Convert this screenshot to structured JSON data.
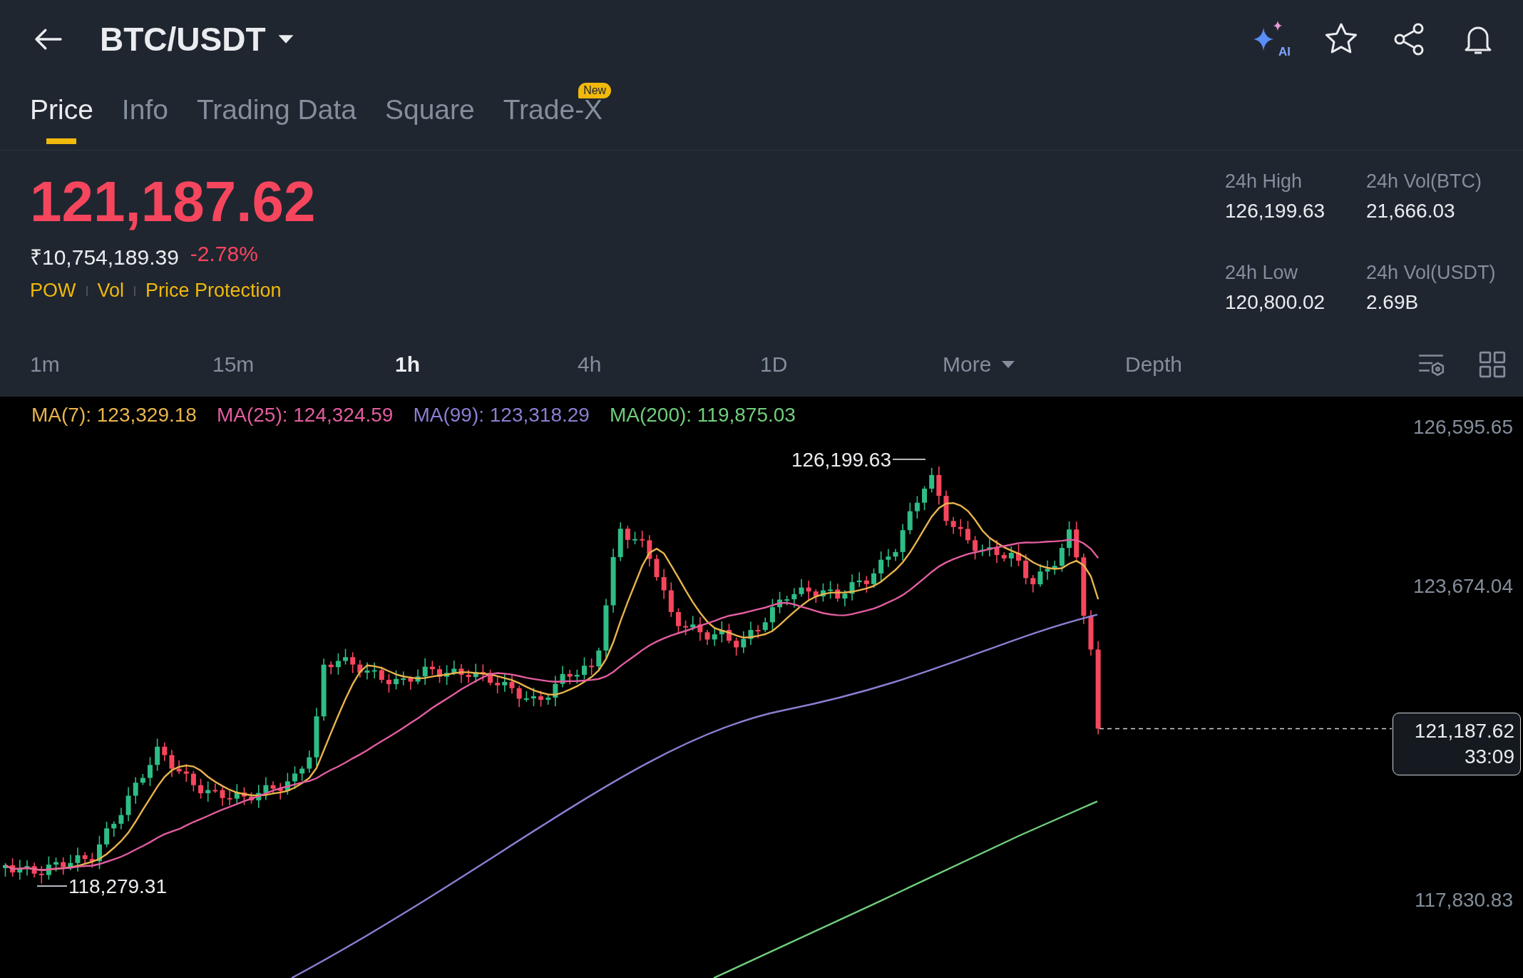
{
  "header": {
    "title": "BTC/USDT",
    "ai_label": "AI"
  },
  "tabs": [
    {
      "label": "Price",
      "selected": true
    },
    {
      "label": "Info",
      "selected": false
    },
    {
      "label": "Trading Data",
      "selected": false
    },
    {
      "label": "Square",
      "selected": false
    },
    {
      "label": "Trade-X",
      "selected": false,
      "badge": "New"
    }
  ],
  "price": {
    "last": "121,187.62",
    "fiat": "₹10,754,189.39",
    "change": "-2.78%",
    "tags": [
      "POW",
      "Vol",
      "Price Protection"
    ]
  },
  "stats": [
    {
      "label": "24h High",
      "value": "126,199.63"
    },
    {
      "label": "24h Vol(BTC)",
      "value": "21,666.03"
    },
    {
      "label": "24h Low",
      "value": "120,800.02"
    },
    {
      "label": "24h Vol(USDT)",
      "value": "2.69B"
    }
  ],
  "intervals": [
    {
      "label": "1m",
      "selected": false,
      "kind": "interval"
    },
    {
      "label": "15m",
      "selected": false,
      "kind": "interval"
    },
    {
      "label": "1h",
      "selected": true,
      "kind": "interval"
    },
    {
      "label": "4h",
      "selected": false,
      "kind": "interval"
    },
    {
      "label": "1D",
      "selected": false,
      "kind": "interval"
    },
    {
      "label": "More",
      "selected": false,
      "kind": "dropdown"
    },
    {
      "label": "Depth",
      "selected": false,
      "kind": "view"
    }
  ],
  "chart": {
    "indicators": [
      {
        "label": "MA(7): 123,329.18",
        "color": "#e9b44c"
      },
      {
        "label": "MA(25): 124,324.59",
        "color": "#e25d9f"
      },
      {
        "label": "MA(99): 123,318.29",
        "color": "#8a7fd2"
      },
      {
        "label": "MA(200): 119,875.03",
        "color": "#6fcf7c"
      }
    ],
    "price_axis": [
      "126,595.65",
      "123,674.04",
      "117,830.83"
    ],
    "high_marker": "126,199.63",
    "low_marker": "118,279.31",
    "price_tag": {
      "price": "121,187.62",
      "countdown": "33:09"
    }
  }
}
